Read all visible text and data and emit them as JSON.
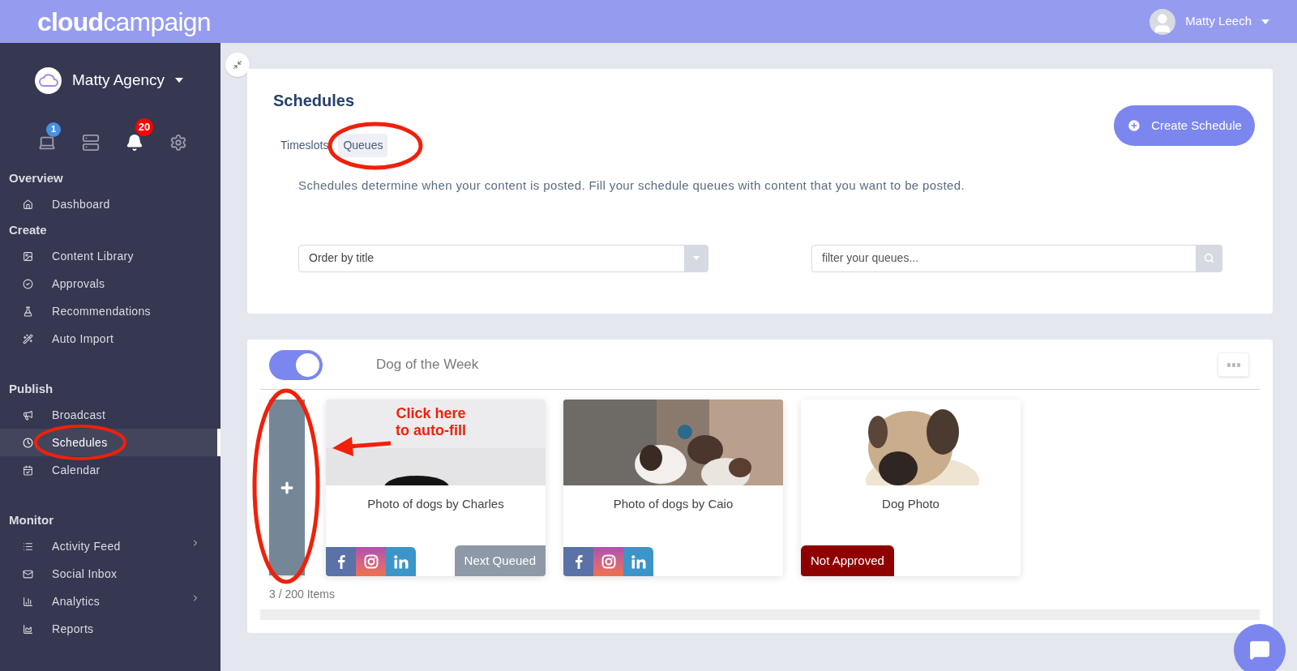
{
  "header": {
    "logo_bold": "cloud",
    "logo_light": "campaign",
    "user": "Matty Leech"
  },
  "sidebar": {
    "account": "Matty Agency",
    "icons": [
      {
        "kind": "laptop",
        "badge": "1"
      },
      {
        "kind": "server"
      },
      {
        "kind": "bell",
        "badge": "20"
      },
      {
        "kind": "gear"
      }
    ],
    "sections": [
      {
        "title": "Overview",
        "items": [
          {
            "label": "Dashboard",
            "selected": false,
            "expandable": false
          }
        ]
      },
      {
        "title": "Create",
        "items": [
          {
            "label": "Content Library",
            "selected": false,
            "expandable": false
          },
          {
            "label": "Approvals",
            "selected": false,
            "expandable": false
          },
          {
            "label": "Recommendations",
            "selected": false,
            "expandable": false
          },
          {
            "label": "Auto Import",
            "selected": false,
            "expandable": false
          }
        ]
      },
      {
        "title": "Publish",
        "items": [
          {
            "label": "Broadcast",
            "selected": false,
            "expandable": false
          },
          {
            "label": "Schedules",
            "selected": true,
            "expandable": false
          },
          {
            "label": "Calendar",
            "selected": false,
            "expandable": false
          }
        ]
      },
      {
        "title": "Monitor",
        "items": [
          {
            "label": "Activity Feed",
            "selected": false,
            "expandable": true
          },
          {
            "label": "Social Inbox",
            "selected": false,
            "expandable": false
          },
          {
            "label": "Analytics",
            "selected": false,
            "expandable": true
          },
          {
            "label": "Reports",
            "selected": false,
            "expandable": false
          }
        ]
      }
    ]
  },
  "page": {
    "title": "Schedules",
    "tabs": [
      {
        "label": "Timeslots",
        "selected": false
      },
      {
        "label": "Queues",
        "selected": true
      }
    ],
    "create_button": "Create Schedule",
    "description": "Schedules determine when your content is posted. Fill your schedule queues with content that you want to be posted.",
    "order_select": {
      "value": "Order by title"
    },
    "filter": {
      "placeholder": "filter your queues..."
    }
  },
  "queue": {
    "on": true,
    "name": "Dog of the Week",
    "count": "3 / 200 Items",
    "items": [
      {
        "title": "Photo of dogs by Charles",
        "networks": true,
        "status": {
          "kind": "queued",
          "text": "Next Queued"
        }
      },
      {
        "title": "Photo of dogs by Caio",
        "networks": true
      },
      {
        "title": "Dog Photo",
        "networks": false,
        "status": {
          "kind": "not_approved",
          "text": "Not Approved"
        }
      }
    ]
  },
  "annotation": {
    "lines": [
      "Click here",
      "to auto-fill"
    ]
  }
}
